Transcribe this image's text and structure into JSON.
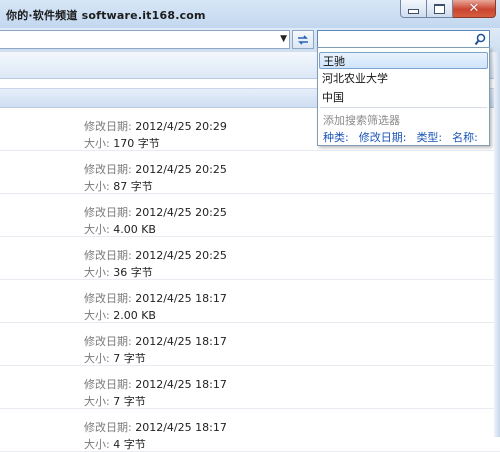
{
  "window": {
    "watermark": "你的·软件频道 software.it168.com",
    "controls": {
      "minimize_icon": "minimize-icon",
      "maximize_icon": "maximize-icon",
      "close_icon": "close-icon"
    }
  },
  "address_bar": {
    "dropdown_icon": "chevron-down-icon",
    "refresh_icon": "refresh-arrows-icon"
  },
  "search": {
    "value": "",
    "icon": "search-icon",
    "suggestions": [
      "王驰",
      "河北农业大学",
      "中国"
    ],
    "filter_title": "添加搜索筛选器",
    "filters": [
      "种类:",
      "修改日期:",
      "类型:",
      "名称:"
    ]
  },
  "files": [
    {
      "date_label": "修改日期:",
      "date": "2012/4/25 20:29",
      "size_label": "大小:",
      "size": "170 字节"
    },
    {
      "date_label": "修改日期:",
      "date": "2012/4/25 20:25",
      "size_label": "大小:",
      "size": "87 字节"
    },
    {
      "date_label": "修改日期:",
      "date": "2012/4/25 20:25",
      "size_label": "大小:",
      "size": "4.00 KB"
    },
    {
      "date_label": "修改日期:",
      "date": "2012/4/25 20:25",
      "size_label": "大小:",
      "size": "36 字节"
    },
    {
      "date_label": "修改日期:",
      "date": "2012/4/25 18:17",
      "size_label": "大小:",
      "size": "2.00 KB"
    },
    {
      "date_label": "修改日期:",
      "date": "2012/4/25 18:17",
      "size_label": "大小:",
      "size": "7 字节"
    },
    {
      "date_label": "修改日期:",
      "date": "2012/4/25 18:17",
      "size_label": "大小:",
      "size": "7 字节"
    },
    {
      "date_label": "修改日期:",
      "date": "2012/4/25 18:17",
      "size_label": "大小:",
      "size": "4 字节"
    }
  ],
  "colors": {
    "accent": "#1a55b8",
    "selection": "#cfe4fb",
    "close": "#c9452f"
  }
}
